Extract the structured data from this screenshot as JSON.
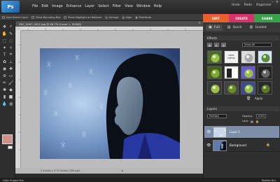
{
  "menu": {
    "logo": "Ps",
    "items": [
      "File",
      "Edit",
      "Image",
      "Enhance",
      "Layer",
      "Select",
      "Filter",
      "View",
      "Window",
      "Help"
    ]
  },
  "topright": {
    "undo": "Undo",
    "redo": "Redo",
    "organizer": "Organizer"
  },
  "options": {
    "auto_select": "Auto Select Layer",
    "bounding_box": "Show Bounding Box",
    "highlight": "Show Highlight on Rollover",
    "arrange": "Arrange",
    "align": "Align",
    "distribute": "Distribute"
  },
  "mode_tabs": {
    "edit": "EDIT",
    "create": "CREATE",
    "share": "SHARE"
  },
  "edit_modes": {
    "full": "Full",
    "quick": "Quick",
    "guided": "Guided"
  },
  "document": {
    "title": "DSC_0067_0001.jpg @ 66.7% (Layer 1, RGB/8)",
    "status": "5 inches x 3.73 inches (300 ppi)"
  },
  "effects": {
    "title": "Effects",
    "filter_select": "Show All",
    "thumb_labels": [
      "color",
      "cotton"
    ],
    "apply_label": "Apply"
  },
  "layers": {
    "title": "Layers",
    "blend_mode": "Multiply",
    "opacity_label": "Opacity:",
    "opacity_value": "100%",
    "lock_label": "Lock:",
    "items": [
      {
        "name": "Layer 1",
        "selected": true
      },
      {
        "name": "Background",
        "selected": false
      }
    ]
  },
  "bottom": {
    "left": "Hide Project Bin",
    "right": "Palette Bin"
  },
  "colors": {
    "foreground": "#cf9089",
    "edit_tab": "#e8612c",
    "create_tab": "#d6336c",
    "share_tab": "#3aa14a",
    "selected_layer": "#7d8fa8"
  }
}
